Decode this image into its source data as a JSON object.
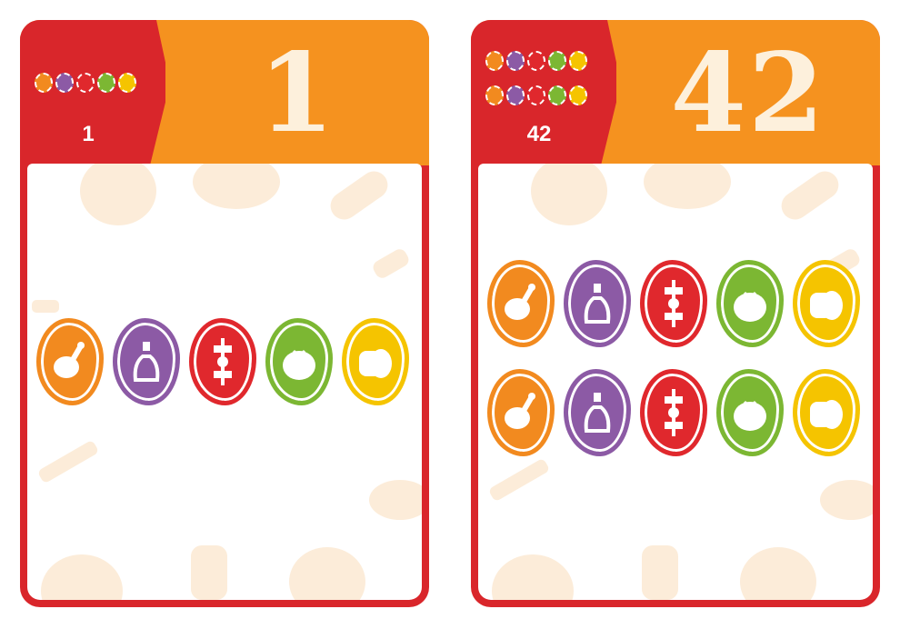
{
  "cards": [
    {
      "value": "1",
      "mini_value": "1",
      "mini_rows": 1,
      "token_rows": 1,
      "tokens": [
        "drumstick-icon",
        "oil-bottle-icon",
        "kebab-icon",
        "tomato-icon",
        "cheese-icon"
      ]
    },
    {
      "value": "42",
      "mini_value": "42",
      "mini_rows": 2,
      "token_rows": 2,
      "tokens": [
        "drumstick-icon",
        "oil-bottle-icon",
        "kebab-icon",
        "tomato-icon",
        "cheese-icon"
      ]
    }
  ],
  "colors": {
    "card_red": "#d9262b",
    "header_orange": "#f5921f",
    "orange": "#f28a1f",
    "purple": "#8c5aa5",
    "red": "#e0282d",
    "green": "#7cb733",
    "yellow": "#f5c400",
    "deco": "#fbe6cc"
  }
}
